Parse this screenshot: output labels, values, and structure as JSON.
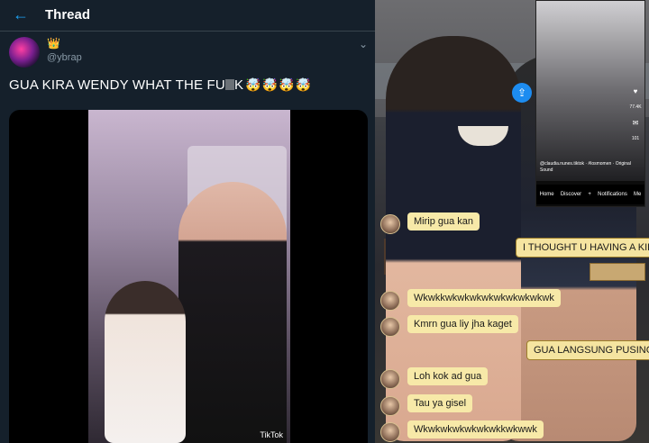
{
  "header": {
    "back_icon": "arrow-left-icon",
    "title": "Thread"
  },
  "tweet": {
    "handle": "@ybrap",
    "badge_icon": "crown-icon",
    "text": "GUA KIRA WENDY WHAT THE FU",
    "text_end": "K",
    "emojis": "🤯🤯🤯🤯",
    "more_icon": "chevron-down-icon"
  },
  "video": {
    "watermark": "TikTok"
  },
  "phone": {
    "caption": "@claudia.nunes.tiktok · #losmomen · Original Sound",
    "side_likes": "77.4K",
    "side_comments": "101",
    "nav": [
      "Home",
      "Discover",
      "+",
      "Notifications",
      "Me"
    ]
  },
  "chat": {
    "messages": [
      {
        "text": "Mirip gua kan",
        "side": "left"
      },
      {
        "text": "I THOUGHT U HAVING A KID",
        "side": "right"
      },
      {
        "text": "Wkwkkwkwkwkwkwkwkwkwkwk",
        "side": "left"
      },
      {
        "text": "Kmrn gua liy jha kaget",
        "side": "left"
      },
      {
        "text": "GUA LANGSUNG PUSING",
        "side": "right"
      },
      {
        "text": "Loh kok ad gua",
        "side": "left"
      },
      {
        "text": "Tau ya gisel",
        "side": "left"
      },
      {
        "text": "Wkwkwkwkwkwkwkkwkwwk",
        "side": "left"
      }
    ]
  },
  "colors": {
    "bg": "#15202b",
    "accent": "#1da1f2",
    "bubble": "#f7e9a8"
  }
}
